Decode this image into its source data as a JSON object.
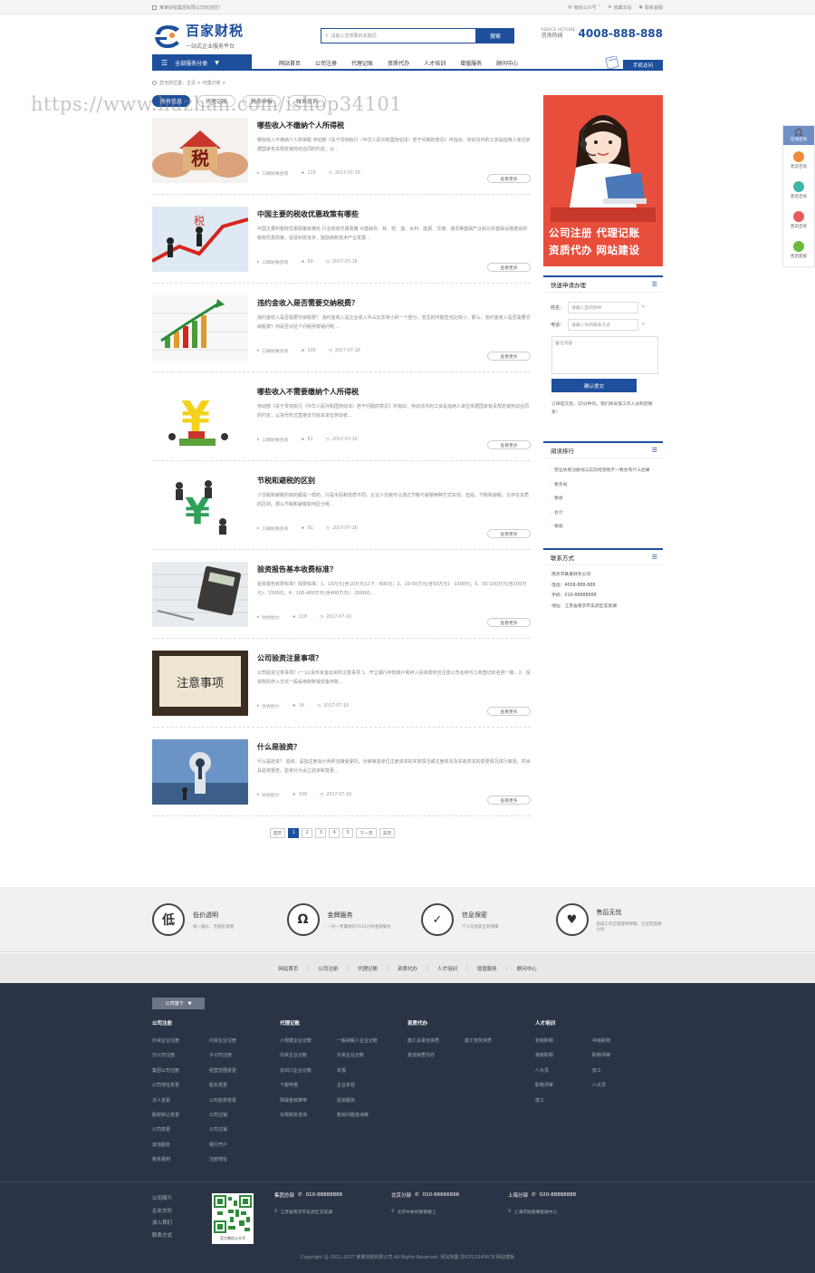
{
  "topbar": {
    "welcome": "某某财税集团有限公司欢迎您！",
    "links": [
      "微信公众号",
      "收藏本站",
      "联系客服"
    ]
  },
  "header": {
    "logo_title": "百家财税",
    "logo_sub": "一站式企业服务平台",
    "search_placeholder": "请输入您想要的关键词",
    "search_button": "搜索",
    "hotline_en": "ADVICE HOTLINE",
    "hotline_cn": "咨询热线",
    "hotline_number": "4008-888-888"
  },
  "nav": {
    "all_services": "全部服务分类",
    "items": [
      "网站首页",
      "公司注册",
      "代理记账",
      "资质代办",
      "人才培训",
      "增值服务",
      "顾问中心"
    ],
    "mobile": "手机访问"
  },
  "breadcrumb": "您当前位置：主页 > 代理记账 >",
  "watermark": "https://www.huzhan.com/ishop34101",
  "tabs": [
    "所有信息",
    "代理记账",
    "税务申报",
    "财务咨询"
  ],
  "articles": [
    {
      "title": "哪些收入不缴纳个人所得税",
      "desc": "哪些收入不缴纳个人所得税 劳动部《关于贯彻执行〈中华人民共和国劳动法〉若干问题的意见》中指出：劳动法中的工资是指用人单位依据国家有关规定或劳动合同的约定，以...",
      "source": "口碑财税咨询",
      "views": "119",
      "date": "2017-07-16",
      "more": "查看更多"
    },
    {
      "title": "中国主要的税收优惠政策有哪些",
      "desc": "中国主要的税收优惠政策有哪些 行业税收优惠政策 对基础农、林、牧、渔、水利、能源、交通、通讯等基础产业和公共基础设施建设的税收优惠政策，促进科技进步，鼓励高新技术产业发展...",
      "source": "口碑财税咨询",
      "views": "69",
      "date": "2017-07-16",
      "more": "查看更多"
    },
    {
      "title": "违约金收入是否需要交纳税费？",
      "desc": "违约金收入是否需要交纳税费？ 违约金收入是企业收入中占比非常小的一个部分，发生的可能性也比较小，那么，违约金收入是否需要交纳税费？你是否对这个问题存有疑问呢...",
      "source": "口碑财税咨询",
      "views": "100",
      "date": "2017-07-16",
      "more": "查看更多"
    },
    {
      "title": "哪些收入不需要缴纳个人所得税",
      "desc": "劳动部《关于贯彻执行〈中华人民共和国劳动法〉若干问题的意见》中指出：劳动法中的工资是指用人单位依据国家有关规定或劳动合同的约定，以货币形式直接支付给本单位劳动者...",
      "source": "口碑财税咨询",
      "views": "81",
      "date": "2017-07-16",
      "more": "查看更多"
    },
    {
      "title": "节税和避税的区别",
      "desc": "少交税和避税的目的都是一样的，只是手段和性质不同。企业少交税可以通过节税与避税两种方式实现，但是，节税和避税，又存在本质的区别。那么节税和避税如何区分呢...",
      "source": "口碑财税咨询",
      "views": "91",
      "date": "2017-07-16",
      "more": "查看更多"
    },
    {
      "title": "验资报告基本收费标准？",
      "desc": "验资报告收费标准？收费标准：1、10万元(含10万元)以下：600元；2、10-50万元(含50万元)：1000元；3、50-100万元(含100万元)：1500元；4、100-400万元(含400万元)：2000元...",
      "source": "财会助力",
      "views": "118",
      "date": "2017-07-16",
      "more": "查看更多"
    },
    {
      "title": "公司验资注意事项？",
      "desc": "公司验资注意事项？(一)以货币资金出资时注意事项 1、开立银行存款账户和存入投资款时应注意公司名称与工商登记的名称一致，2、投资款的存入方式一般采用转账或现金存款...",
      "source": "财会助力",
      "views": "34",
      "date": "2017-07-16",
      "more": "查看更多"
    },
    {
      "title": "什么是验资？",
      "desc": "什么是验资？ 验资，是指注册会计师依法接受委托，对被审验单位注册资本的实收情况或注册资本及实收资本的变更情况进行审验，并出具验资报告。验资分为设立验资和变更...",
      "source": "财会助力",
      "views": "109",
      "date": "2017-07-16",
      "more": "查看更多"
    }
  ],
  "pager": [
    "首页",
    "1",
    "2",
    "3",
    "4",
    "5",
    "下一页",
    "末页"
  ],
  "sidebar": {
    "banner_line1": "公司注册 代理记账",
    "banner_line2": "资质代办 网站建设",
    "quick_title": "快速申请办理",
    "name_label": "姓名：",
    "name_placeholder": "请输入您的称呼",
    "phone_label": "电话：",
    "phone_placeholder": "请输入你的联系方式",
    "note_placeholder": "备注内容",
    "submit": "确认提交",
    "note": "订单提交后，10分钟内，我们将安排工作人员和您联系！",
    "rank_title": "阅读排行",
    "rank_items": [
      "· 营业执照注册地与实际经营地不一致会有什么后果",
      "· 税务局",
      "· 税收",
      "· 会计",
      "· 税收"
    ],
    "contact_title": "联系方式",
    "contact_lines": [
      "南京市某某财务公司",
      "电话：4008-888-888",
      "手机：010-88888888",
      "地址：江苏省南京市玄武区玄武湖"
    ]
  },
  "float_bar": {
    "head": "在线咨询",
    "items": [
      "售前咨询",
      "售后咨询",
      "售前咨询",
      "售后客服"
    ],
    "colors": [
      "#f08a3c",
      "#3cb6a8",
      "#e85a5a",
      "#6cbb3c"
    ]
  },
  "features": [
    {
      "icon": "低",
      "title": "低价透明",
      "sub": "统一报价，无隐形消费"
    },
    {
      "icon": "Ω",
      "title": "金牌服务",
      "sub": "一对一专属顾问7X24小时金牌服务"
    },
    {
      "icon": "✓",
      "title": "信息保密",
      "sub": "个人信息安全有保障"
    },
    {
      "icon": "♥",
      "title": "售后无忧",
      "sub": "后续工作全程提供保障，让您无后顾之忧"
    }
  ],
  "footer_nav": [
    "网站首页",
    "公司注册",
    "代理记账",
    "资质代办",
    "人才培训",
    "增值服务",
    "顾问中心"
  ],
  "footer": {
    "tag": "公司旗下",
    "columns": [
      {
        "head": "公司注册",
        "links": [
          "外资企业注册",
          "内资企业注册",
          "分公司注册",
          "子公司注册",
          "集团公司注册",
          "经营范围变更",
          "公司地址变更",
          "股东变更",
          "法人变更",
          "公司名称变更",
          "股权转让变更",
          "公司注销",
          "公司变更",
          "公司注销",
          "其他服务",
          "银行开户",
          "税务报到",
          "注册地址"
        ]
      },
      {
        "head": "代理记账",
        "links": [
          "小规模企业记账",
          "一般纳税人企业记账",
          "内资企业记账",
          "外资企业记账",
          "进出口企业记账",
          "年报",
          "个税申报",
          "企业年检",
          "残保金核算申",
          "验资服务",
          "日常财务咨询",
          "账目问题咨询等"
        ]
      },
      {
        "head": "资质代办",
        "links": [
          "施工总承包资质",
          "施工劳务资质",
          "其他资质代办"
        ]
      },
      {
        "head": "人才培训",
        "links": [
          "初级职称",
          "中级职称",
          "高级职称",
          "职称评审",
          "八大员",
          "技工",
          "职称评审",
          "八大员",
          "技工"
        ]
      }
    ],
    "links": [
      "公司简介",
      "企业文化",
      "加入我们",
      "联系方式"
    ],
    "qr_caption": "官方微信公众号",
    "offices": [
      {
        "name": "集团总部",
        "phone": "010-88888888",
        "addr": "江苏省南京市玄武区玄武湖"
      },
      {
        "name": "北京分部",
        "phone": "010-66666666",
        "addr": "北京中关村某某路上"
      },
      {
        "name": "上海分部",
        "phone": "020-88888888",
        "addr": "上海市陆家嘴金融中心"
      }
    ],
    "copyright": "Copyright @ 2011-2017 某某财税有限公司 All Rights Reserved.   网站地图   苏ICP12345678   网站模板"
  }
}
